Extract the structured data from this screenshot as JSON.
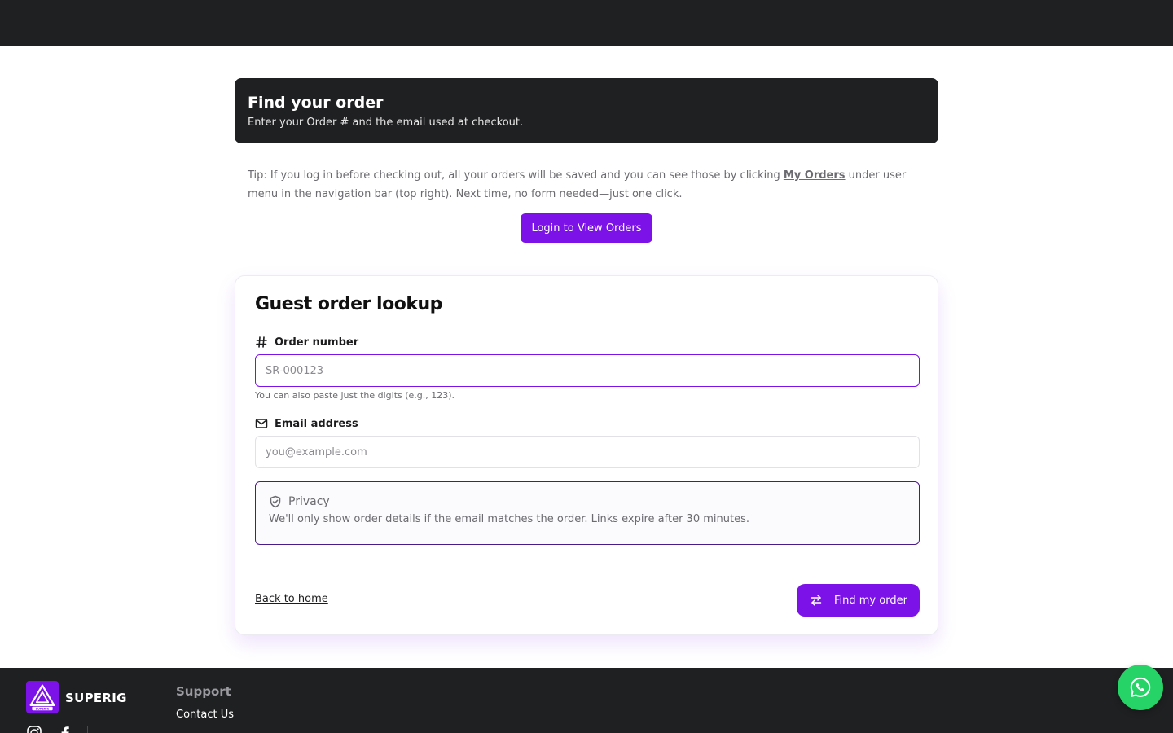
{
  "hero": {
    "title": "Find your order",
    "subtitle": "Enter your Order # and the email used at checkout."
  },
  "tip": {
    "text_before": "Tip: If you log in before checking out, all your orders will be saved and you can see those by clicking ",
    "link_label": "My Orders",
    "text_after": " under user menu in the navigation bar (top right). Next time, no form needed—just one click."
  },
  "login_button": {
    "label": "Login to View Orders"
  },
  "card": {
    "title": "Guest order lookup",
    "order_field": {
      "label": "Order number",
      "value": "",
      "placeholder": "SR-000123",
      "hint": "You can also paste just the digits (e.g., 123)."
    },
    "email_field": {
      "label": "Email address",
      "value": "",
      "placeholder": "you@example.com"
    },
    "privacy": {
      "title": "Privacy",
      "body": "We'll only show order details if the email matches the order. Links expire after 30 minutes."
    },
    "back_link": "Back to home",
    "submit_label": "Find my order"
  },
  "footer": {
    "brand": "SUPERIG",
    "logo_tag": "SUPERIG",
    "support_heading": "Support",
    "contact_link": "Contact Us"
  },
  "colors": {
    "accent": "#7c12e8",
    "dark": "#1f2022",
    "whatsapp": "#25d366"
  },
  "icons": {
    "order_label": "hash-icon",
    "email_label": "mail-icon",
    "privacy": "shield-check-icon",
    "submit": "arrows-swap-icon",
    "floating": "whatsapp-icon",
    "social": [
      "instagram-icon",
      "facebook-icon"
    ]
  }
}
